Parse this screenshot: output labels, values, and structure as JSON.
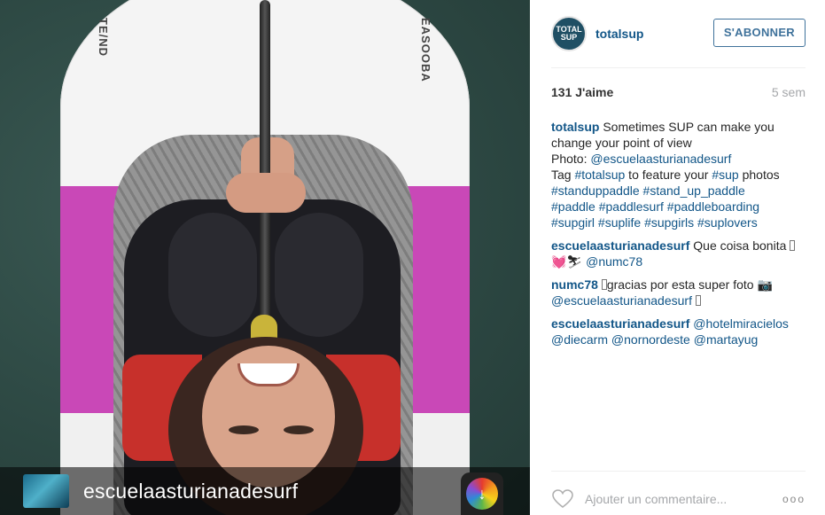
{
  "photo": {
    "board_text_left": "TE/ND",
    "board_text_right": "EASOOBA",
    "footer_username": "escuelaasturianadesurf",
    "footer_icon": "rainbow-download-icon"
  },
  "post": {
    "avatar_text": "TOTAL SUP",
    "username": "totalsup",
    "follow_label": "S'ABONNER",
    "likes": "131 J'aime",
    "time": "5 sem"
  },
  "caption": {
    "user": "totalsup",
    "text1": " Sometimes SUP can make you change your point of view",
    "text2": "Photo: ",
    "mention1": "@escuelaasturianadesurf",
    "text3": "Tag ",
    "tag_totalsup": "#totalsup",
    "text4": " to feature your ",
    "tag_sup": "#sup",
    "text5": " photos",
    "tag_standuppaddle": "#standuppaddle",
    "tag_stand_up_paddle": "#stand_up_paddle",
    "tag_paddle": "#paddle",
    "tag_paddlesurf": "#paddlesurf",
    "tag_paddleboarding": "#paddleboarding",
    "tag_supgirl": "#supgirl",
    "tag_suplife": "#suplife",
    "tag_supgirls": "#supgirls",
    "tag_suplovers": "#suplovers"
  },
  "comments": [
    {
      "user": "escuelaasturianadesurf",
      "text": " Que coisa bonita ",
      "emoji": "💓⛷",
      "mention": "@numc78"
    },
    {
      "user": "numc78",
      "text": "gracias por esta super foto 📷",
      "mention": "@escuelaasturianadesurf"
    },
    {
      "user": "escuelaasturianadesurf",
      "mention1": "@hotelmiracielos",
      "mention2": "@diecarm",
      "mention3": "@nornordeste",
      "mention4": "@martayug"
    }
  ],
  "add_comment": {
    "placeholder": "Ajouter un commentaire...",
    "more": "ooo"
  }
}
